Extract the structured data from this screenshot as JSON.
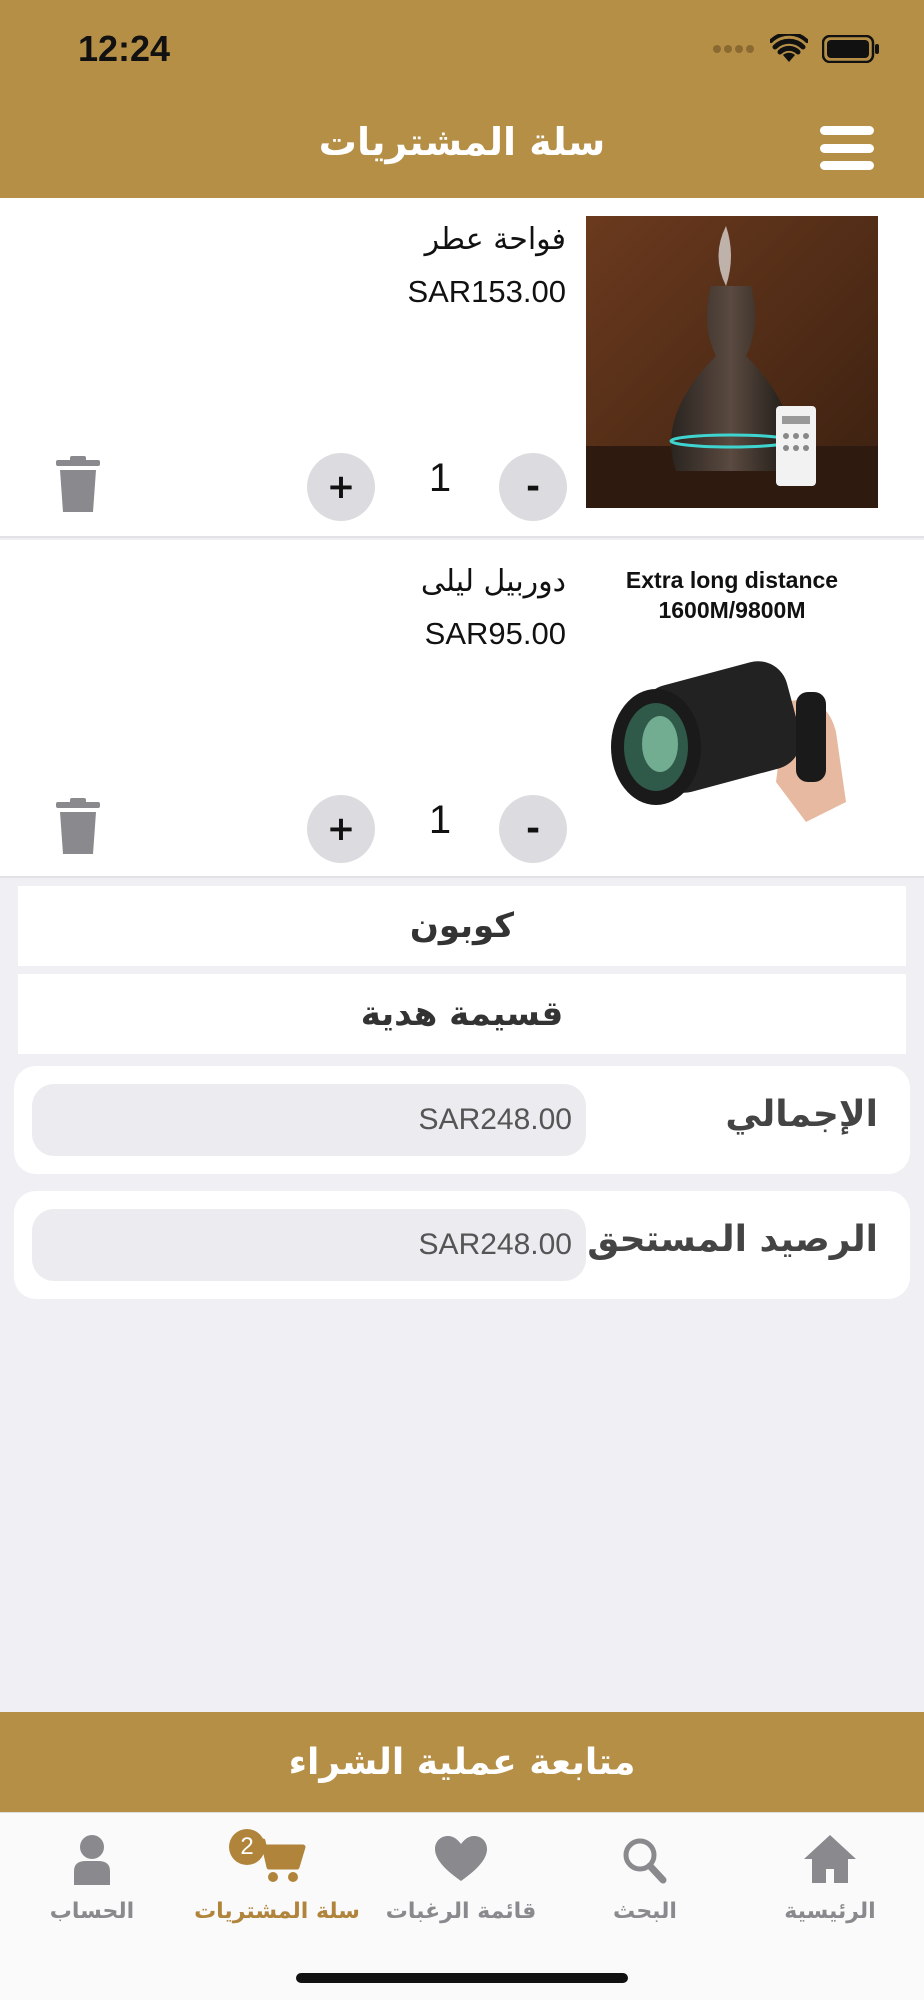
{
  "status_bar": {
    "time": "12:24"
  },
  "header": {
    "title": "سلة المشتريات"
  },
  "cart_items": [
    {
      "name": "فواحة عطر",
      "price": "SAR153.00",
      "quantity": "1",
      "minus_label": "-",
      "plus_label": "+"
    },
    {
      "name": "دوربيل ليلى",
      "price": "SAR95.00",
      "quantity": "1",
      "minus_label": "-",
      "plus_label": "+",
      "image_text_line1": "Extra long distance",
      "image_text_line2": "1600M/9800M"
    }
  ],
  "options": {
    "coupon": "كوبون",
    "gift_card": "قسيمة هدية"
  },
  "summary": {
    "total_label": "الإجمالي",
    "total_value": "SAR248.00",
    "due_label": "الرصيد المستحق",
    "due_value": "SAR248.00"
  },
  "checkout_label": "متابعة عملية الشراء",
  "tabs": [
    {
      "label": "الرئيسية",
      "icon": "home-icon"
    },
    {
      "label": "البحث",
      "icon": "search-icon"
    },
    {
      "label": "قائمة الرغبات",
      "icon": "heart-icon"
    },
    {
      "label": "سلة المشتريات",
      "icon": "cart-icon",
      "badge": "2",
      "active": true
    },
    {
      "label": "الحساب",
      "icon": "user-icon"
    }
  ],
  "colors": {
    "brand": "#b68f47",
    "active_tab": "#b0843a",
    "background": "#efeff4"
  }
}
